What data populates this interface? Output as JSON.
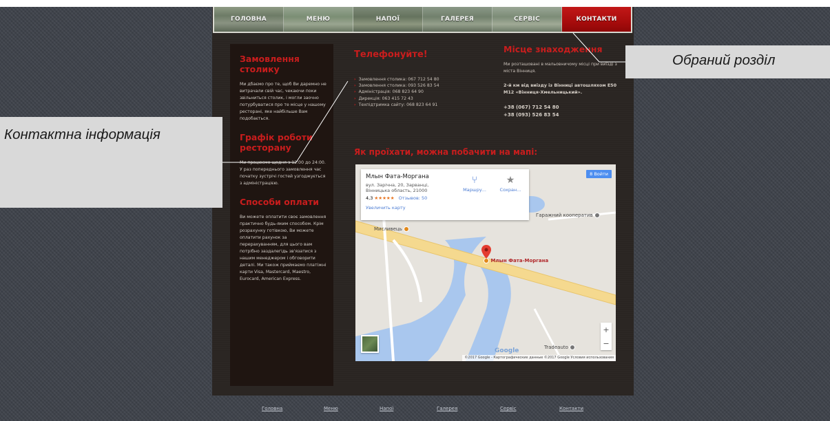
{
  "nav": {
    "items": [
      {
        "label": "ГОЛОВНА",
        "active": false
      },
      {
        "label": "МЕНЮ",
        "active": false
      },
      {
        "label": "НАПОЇ",
        "active": false
      },
      {
        "label": "ГАЛЕРЕЯ",
        "active": false
      },
      {
        "label": "СЕРВІС",
        "active": false
      },
      {
        "label": "КОНТАКТИ",
        "active": true
      }
    ]
  },
  "left": {
    "order_title": "Замовлення столику",
    "order_text": "Ми дбаємо про те, щоб Ви даремно не витрачали свій час, чекаючи поки звільниться столик, і могли заочно потурбуватися про те місце у нашому ресторані, яке найбільше Вам подобається.",
    "schedule_title": "Графік роботи ресторану",
    "schedule_text": "Ми працюємо щодня з 12:00 до 24:00. У раз попереднього замовлення час початку зустрічі гостей узгоджується з адміністрацією.",
    "payment_title": "Способи оплати",
    "payment_text": "Ви можете оплатити своє замовлення практично будь-яким способом. Крім розрахунку готівкою, Ви можете оплатити рахунок за перерахуванням, для цього вам потрібно заздалегідь зв'язатися з нашим менеджером і обговорити деталі. Ми також приймаємо платіжні карти Visa, Mastercard, Maestro, Eurocard, American Express."
  },
  "middle": {
    "title": "Телефонуйте!",
    "phones": [
      "Замовлення столика: 067 712 54 80",
      "Замовлення столика: 093 526 83 54",
      "Адміністрація: 068 823 64 90",
      "Дирекція: 063 415 72 43",
      "Техпідтримка сайту: 068 823 64 91"
    ]
  },
  "right": {
    "title": "Місце знаходження",
    "text": "Ми розташовані в мальовничому місці при виїзді з міста Вінниця.",
    "bold_text": "2-й км від виїзду із Вінниці автошляхом Е50 М12 «Вінниця-Хмельницький».",
    "phone1": "+38 (067) 712 54 80",
    "phone2": "+38 (093) 526 83 54"
  },
  "map_heading": "Як проїхати, можна побачити на мапі:",
  "map": {
    "place_name": "Млын Фата-Моргана",
    "address": "вул. Зарічна, 20, Зарванці, Вінницька область, 21000",
    "rating": "4,3",
    "stars": "★★★★★",
    "reviews": "Отзывов: 50",
    "larger_map": "Увеличить карту",
    "route_label": "Маршру...",
    "save_label": "Сохран...",
    "signin_label": "8 Войти",
    "label_garage": "Гаражний кооператив",
    "label_hunter": "Мисливець",
    "label_marker": "Млын Фата-Моргана",
    "label_tradeauto": "Tradeauto",
    "google": "Google",
    "footer": "©2017 Google - Картографические данные ©2017 Google   Условия использования",
    "zoom_in": "+",
    "zoom_out": "−"
  },
  "footer_links": [
    "Головна",
    "Меню",
    "Напої",
    "Галерея",
    "Сервіс",
    "Контакти"
  ],
  "callouts": {
    "contact_info": "Контактна інформація",
    "selected_section": "Обраний розділ"
  }
}
